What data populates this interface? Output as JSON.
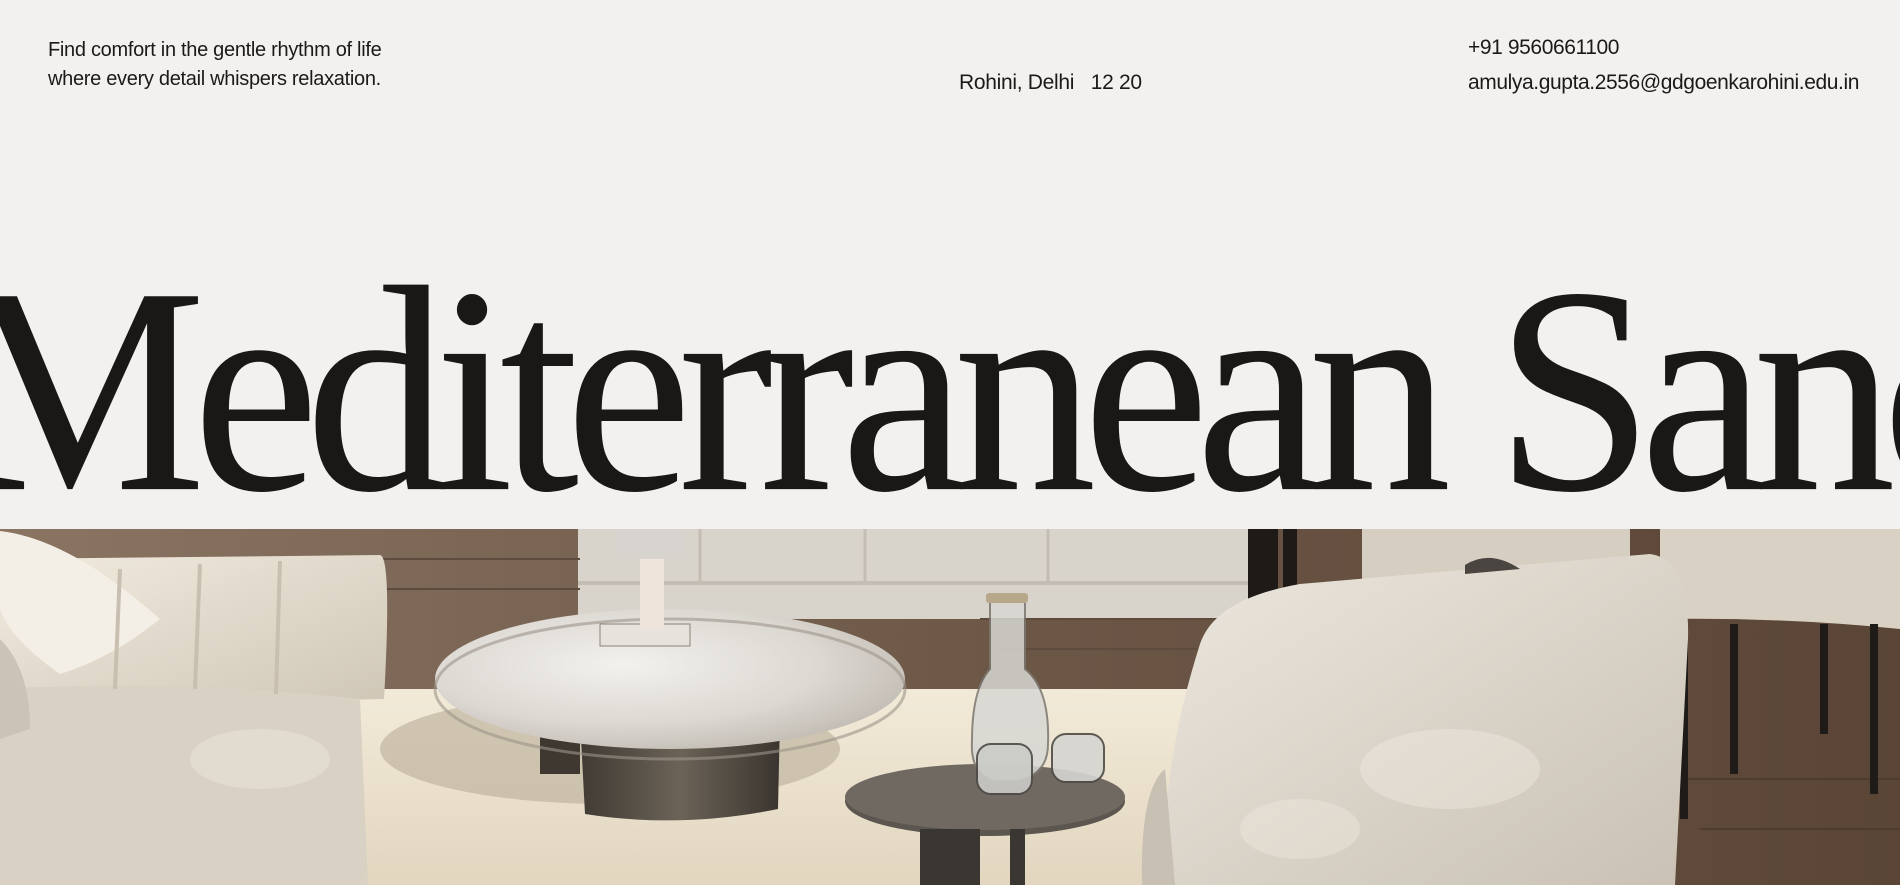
{
  "header": {
    "tagline_line1": "Find comfort in the gentle rhythm of life",
    "tagline_line2": "where every detail whispers relaxation.",
    "location": "Rohini, Delhi   12 20",
    "phone": "+91 9560661100",
    "email": "amulya.gupta.2556@gdgoenkarohini.edu.in"
  },
  "hero": {
    "title": "Mediterranean Sanctuary"
  },
  "colors": {
    "background": "#f2f1ef",
    "text": "#1c1a18",
    "floor": "#7a6350",
    "rug": "#eee5d3"
  },
  "image": {
    "icon": "living-room-photo"
  }
}
